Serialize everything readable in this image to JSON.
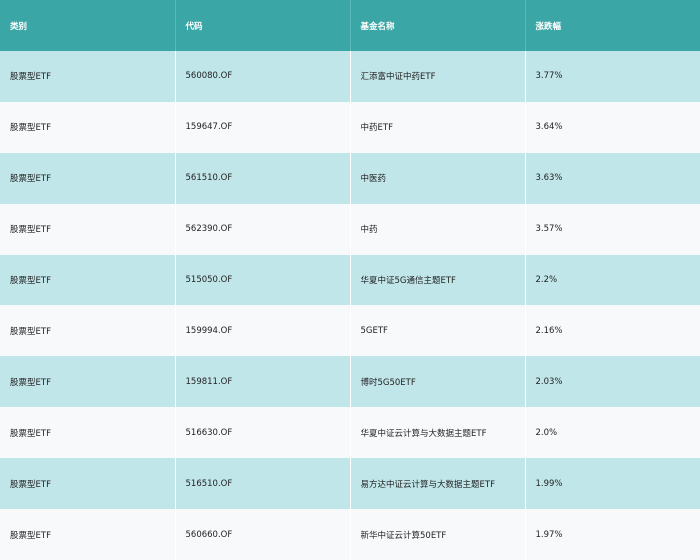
{
  "colors": {
    "header_bg": "#3aa6a6",
    "row_odd": "#c1e6ea",
    "row_even": "#f8f9fb"
  },
  "headers": [
    "类别",
    "代码",
    "基金名称",
    "涨跌幅"
  ],
  "rows": [
    [
      "股票型ETF",
      "560080.OF",
      "汇添富中证中药ETF",
      "3.77%"
    ],
    [
      "股票型ETF",
      "159647.OF",
      "中药ETF",
      "3.64%"
    ],
    [
      "股票型ETF",
      "561510.OF",
      "中医药",
      "3.63%"
    ],
    [
      "股票型ETF",
      "562390.OF",
      "中药",
      "3.57%"
    ],
    [
      "股票型ETF",
      "515050.OF",
      "华夏中证5G通信主题ETF",
      "2.2%"
    ],
    [
      "股票型ETF",
      "159994.OF",
      "5GETF",
      "2.16%"
    ],
    [
      "股票型ETF",
      "159811.OF",
      "博时5G50ETF",
      "2.03%"
    ],
    [
      "股票型ETF",
      "516630.OF",
      "华夏中证云计算与大数据主题ETF",
      "2.0%"
    ],
    [
      "股票型ETF",
      "516510.OF",
      "易方达中证云计算与大数据主题ETF",
      "1.99%"
    ],
    [
      "股票型ETF",
      "560660.OF",
      "新华中证云计算50ETF",
      "1.97%"
    ]
  ]
}
